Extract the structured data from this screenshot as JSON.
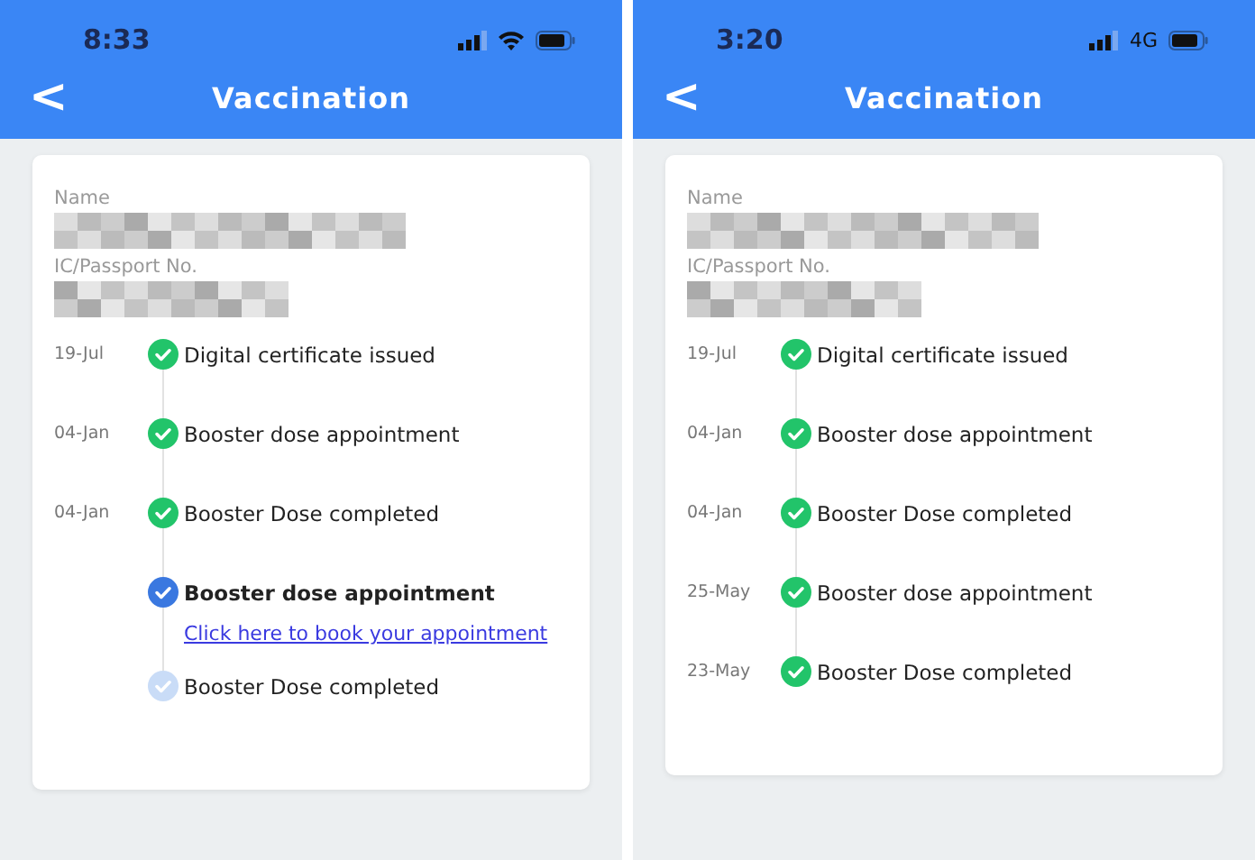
{
  "phones": [
    {
      "status_bar": {
        "time": "8:33",
        "network": {
          "kind": "wifi"
        }
      },
      "header": {
        "back": "<",
        "title": "Vaccination"
      },
      "fields": [
        {
          "label": "Name"
        },
        {
          "label": "IC/Passport No."
        }
      ],
      "timeline": [
        {
          "date": "19-Jul",
          "title": "Digital certificate issued",
          "completed": true,
          "active": false
        },
        {
          "date": "04-Jan",
          "title": "Booster dose appointment",
          "completed": true,
          "active": false
        },
        {
          "date": "04-Jan",
          "title": "Booster Dose completed",
          "completed": true,
          "active": false
        },
        {
          "title": "Booster dose appointment",
          "completed": false,
          "active": true,
          "link": "Click here to book your appointment"
        },
        {
          "title": "Booster Dose completed",
          "completed": false,
          "active": false
        }
      ]
    },
    {
      "status_bar": {
        "time": "3:20",
        "network": {
          "kind": "text",
          "label": "4G"
        }
      },
      "header": {
        "back": "<",
        "title": "Vaccination"
      },
      "fields": [
        {
          "label": "Name"
        },
        {
          "label": "IC/Passport No."
        }
      ],
      "timeline": [
        {
          "date": "19-Jul",
          "title": "Digital certificate issued",
          "completed": true,
          "active": false
        },
        {
          "date": "04-Jan",
          "title": "Booster dose appointment",
          "completed": true,
          "active": false
        },
        {
          "date": "04-Jan",
          "title": "Booster Dose completed",
          "completed": true,
          "active": false
        },
        {
          "date": "25-May",
          "title": "Booster dose appointment",
          "completed": true,
          "active": false
        },
        {
          "date": "23-May",
          "title": "Booster Dose completed",
          "completed": true,
          "active": false
        }
      ]
    }
  ]
}
